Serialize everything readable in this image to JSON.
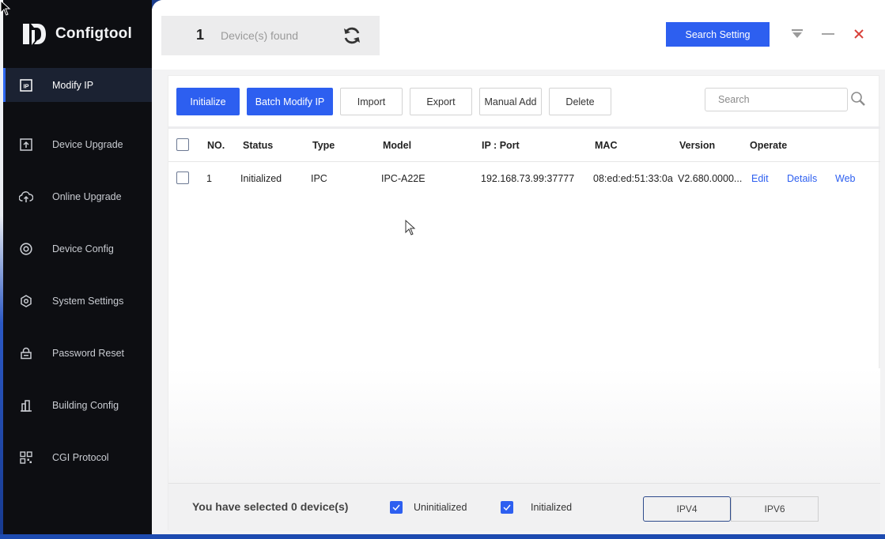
{
  "app": {
    "name": "Configtool"
  },
  "sidebar": {
    "items": [
      {
        "label": "Modify IP",
        "icon": "ip-icon",
        "active": true
      },
      {
        "label": "Device Upgrade",
        "icon": "upgrade-icon"
      },
      {
        "label": "Online Upgrade",
        "icon": "cloud-upload-icon"
      },
      {
        "label": "Device Config",
        "icon": "target-icon"
      },
      {
        "label": "System Settings",
        "icon": "gear-icon"
      },
      {
        "label": "Password Reset",
        "icon": "lock-icon"
      },
      {
        "label": "Building Config",
        "icon": "building-icon"
      },
      {
        "label": "CGI Protocol",
        "icon": "grid-icon"
      }
    ]
  },
  "header": {
    "found_count": "1",
    "found_label": "Device(s) found",
    "search_setting_label": "Search Setting"
  },
  "toolbar": {
    "initialize": "Initialize",
    "batch_modify_ip": "Batch Modify IP",
    "import": "Import",
    "export": "Export",
    "manual_add": "Manual Add",
    "delete": "Delete",
    "search_placeholder": "Search"
  },
  "table": {
    "columns": [
      "NO.",
      "Status",
      "Type",
      "Model",
      "IP : Port",
      "MAC",
      "Version",
      "Operate"
    ],
    "rows": [
      {
        "no": "1",
        "status": "Initialized",
        "type": "IPC",
        "model": "IPC-A22E",
        "ip_port": "192.168.73.99:37777",
        "mac": "08:ed:ed:51:33:0a",
        "version": "V2.680.0000...",
        "actions": [
          "Edit",
          "Details",
          "Web"
        ]
      }
    ]
  },
  "footer": {
    "selected_text": "You have selected 0  device(s)",
    "filter_uninitialized": "Uninitialized",
    "filter_initialized": "Initialized",
    "ipv4": "IPV4",
    "ipv6": "IPV6"
  },
  "colors": {
    "accent": "#2d5ff0",
    "sidebar_bg": "#0d0e12",
    "close": "#d9433c"
  }
}
